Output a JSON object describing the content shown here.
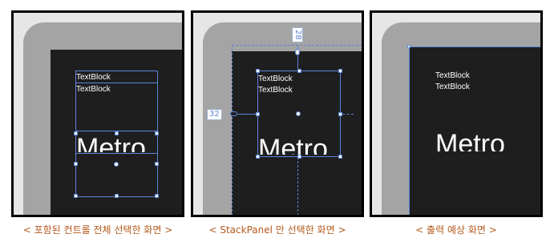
{
  "panels": [
    {
      "textblock1": "TextBlock",
      "textblock2": "TextBlock",
      "metro": "Metro",
      "caption": "< 포함된 컨트롤 전체 선택한 화면 >"
    },
    {
      "textblock1": "TextBlock",
      "textblock2": "TextBlock",
      "metro": "Metro",
      "margin_top": "28",
      "margin_left": "32",
      "caption": "< StackPanel 만 선택한 화면 >"
    },
    {
      "textblock1": "TextBlock",
      "textblock2": "TextBlock",
      "metro": "Metro",
      "caption": "< 출력 예상 화면 >"
    }
  ],
  "colors": {
    "selection": "#5b86d8",
    "caption": "#b45a1e",
    "screen": "#1e1e1e",
    "bezel": "#a4a4a4"
  }
}
